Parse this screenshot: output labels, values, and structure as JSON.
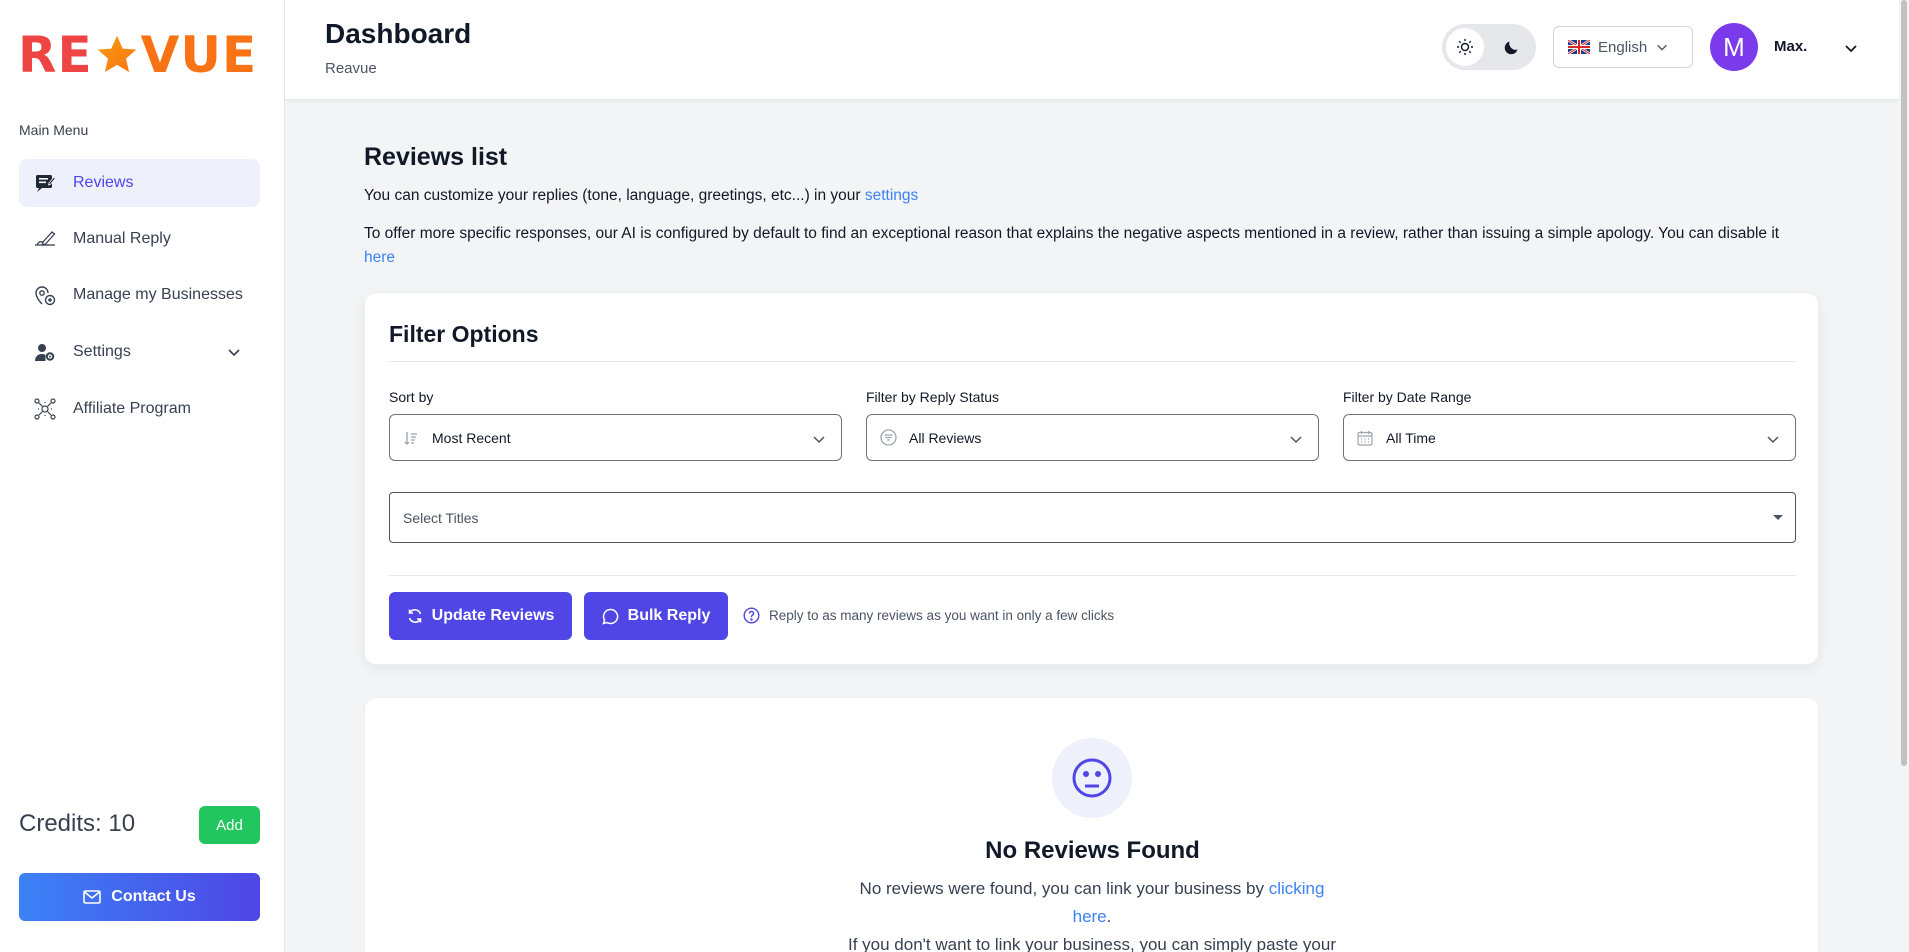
{
  "brand": {
    "logo_left": "RE",
    "logo_right": "VUE"
  },
  "sidebar": {
    "menu_title": "Main Menu",
    "items": [
      {
        "label": "Reviews",
        "icon": "reviews-icon",
        "active": true
      },
      {
        "label": "Manual Reply",
        "icon": "pen-hand-icon"
      },
      {
        "label": "Manage my Businesses",
        "icon": "location-add-icon"
      },
      {
        "label": "Settings",
        "icon": "user-gear-icon",
        "expandable": true
      },
      {
        "label": "Affiliate Program",
        "icon": "network-icon"
      }
    ],
    "credits_label": "Credits: 10",
    "add_label": "Add",
    "contact_label": "Contact Us"
  },
  "header": {
    "title": "Dashboard",
    "subtitle": "Reavue",
    "language": "English",
    "avatar_letter": "M",
    "user_name": "Max."
  },
  "main": {
    "title": "Reviews list",
    "intro_text": "You can customize your replies (tone, language, greetings, etc...) in your ",
    "intro_link": "settings",
    "ai_text": "To offer more specific responses, our AI is configured by default to find an exceptional reason that explains the negative aspects mentioned in a review, rather than issuing a simple apology. You can disable it ",
    "ai_link": "here",
    "filters": {
      "title": "Filter Options",
      "sort_label": "Sort by",
      "sort_value": "Most Recent",
      "status_label": "Filter by Reply Status",
      "status_value": "All Reviews",
      "date_label": "Filter by Date Range",
      "date_value": "All Time",
      "titles_placeholder": "Select Titles",
      "update_label": "Update Reviews",
      "bulk_label": "Bulk Reply",
      "hint": "Reply to as many reviews as you want in only a few clicks"
    },
    "empty": {
      "title": "No Reviews Found",
      "text": "No reviews were found, you can link your business by ",
      "link": "clicking here",
      "text2": ".",
      "text3": "If you don't want to link your business, you can simply paste your"
    }
  },
  "colors": {
    "primary": "#4f46e5",
    "green": "#22c55e",
    "link": "#3b82f6"
  }
}
